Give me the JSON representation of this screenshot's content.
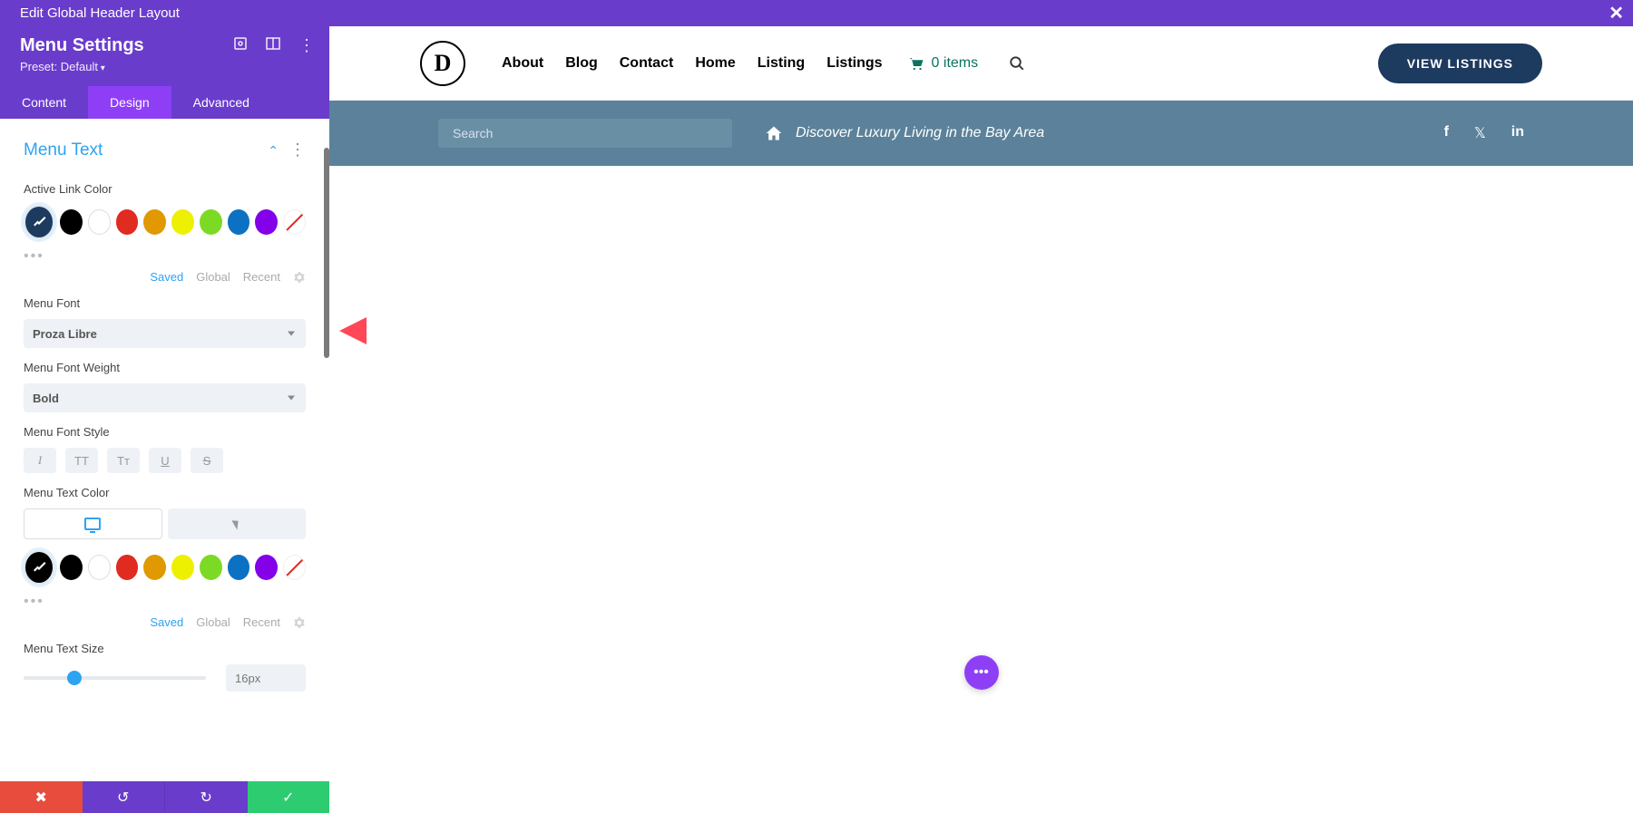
{
  "topbar": {
    "title": "Edit Global Header Layout"
  },
  "settings": {
    "title": "Menu Settings",
    "preset": "Preset: Default"
  },
  "tabs": {
    "content": "Content",
    "design": "Design",
    "advanced": "Advanced"
  },
  "section": {
    "title": "Menu Text",
    "active_link_color": "Active Link Color",
    "menu_font": "Menu Font",
    "font_value": "Proza Libre",
    "menu_font_weight": "Menu Font Weight",
    "weight_value": "Bold",
    "menu_font_style": "Menu Font Style",
    "menu_text_color": "Menu Text Color",
    "menu_text_size": "Menu Text Size",
    "size_value": "16px",
    "style_btns": {
      "italic": "I",
      "upper": "TT",
      "title": "Tᴛ",
      "underline": "U",
      "strike": "S"
    }
  },
  "color_meta": {
    "saved": "Saved",
    "global": "Global",
    "recent": "Recent"
  },
  "nav": {
    "items": [
      "About",
      "Blog",
      "Contact",
      "Home",
      "Listing",
      "Listings"
    ],
    "cart": "0 items",
    "cta": "VIEW LISTINGS"
  },
  "subbar": {
    "search_placeholder": "Search",
    "tagline": "Discover Luxury Living in the Bay Area"
  }
}
